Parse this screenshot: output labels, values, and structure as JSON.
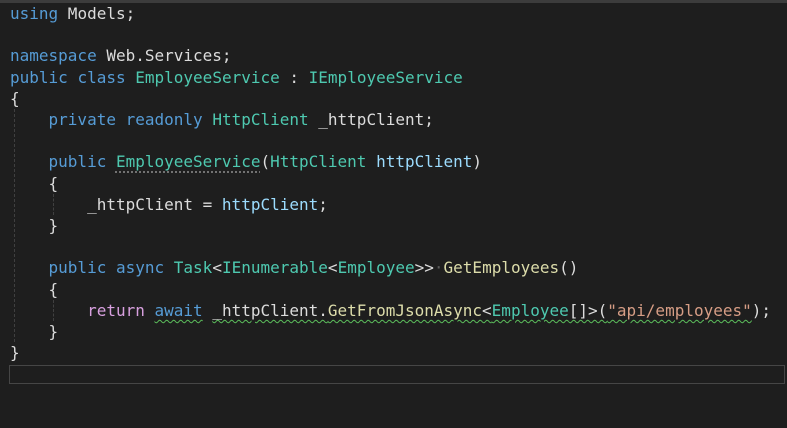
{
  "lines": [
    [
      {
        "t": "using",
        "c": "kw"
      },
      {
        "t": " Models;",
        "c": "pl"
      }
    ],
    [],
    [
      {
        "t": "namespace",
        "c": "kw"
      },
      {
        "t": " Web.Services;",
        "c": "pl"
      }
    ],
    [
      {
        "t": "public",
        "c": "kw"
      },
      {
        "t": " ",
        "c": "pl"
      },
      {
        "t": "class",
        "c": "kw"
      },
      {
        "t": " ",
        "c": "pl"
      },
      {
        "t": "EmployeeService",
        "c": "ty"
      },
      {
        "t": " : ",
        "c": "pl"
      },
      {
        "t": "IEmployeeService",
        "c": "ty"
      }
    ],
    [
      {
        "t": "{",
        "c": "pl"
      }
    ],
    [
      {
        "t": "    ",
        "c": "pl"
      },
      {
        "t": "private",
        "c": "kw"
      },
      {
        "t": " ",
        "c": "pl"
      },
      {
        "t": "readonly",
        "c": "kw"
      },
      {
        "t": " ",
        "c": "pl"
      },
      {
        "t": "HttpClient",
        "c": "ty"
      },
      {
        "t": " _httpClient;",
        "c": "pl"
      }
    ],
    [],
    [
      {
        "t": "    ",
        "c": "pl"
      },
      {
        "t": "public",
        "c": "kw"
      },
      {
        "t": " ",
        "c": "pl"
      },
      {
        "t": "EmployeeService",
        "c": "ty dots"
      },
      {
        "t": "(",
        "c": "pl"
      },
      {
        "t": "HttpClient",
        "c": "ty"
      },
      {
        "t": " ",
        "c": "pl"
      },
      {
        "t": "httpClient",
        "c": "pa"
      },
      {
        "t": ")",
        "c": "pl"
      }
    ],
    [
      {
        "t": "    {",
        "c": "pl"
      }
    ],
    [
      {
        "t": "        _httpClient = ",
        "c": "pl"
      },
      {
        "t": "httpClient",
        "c": "pa"
      },
      {
        "t": ";",
        "c": "pl"
      }
    ],
    [
      {
        "t": "    }",
        "c": "pl"
      }
    ],
    [],
    [
      {
        "t": "    ",
        "c": "pl"
      },
      {
        "t": "public",
        "c": "kw"
      },
      {
        "t": " ",
        "c": "pl"
      },
      {
        "t": "async",
        "c": "kw"
      },
      {
        "t": " ",
        "c": "pl"
      },
      {
        "t": "Task",
        "c": "ty"
      },
      {
        "t": "<",
        "c": "pl"
      },
      {
        "t": "IEnumerable",
        "c": "ty"
      },
      {
        "t": "<",
        "c": "pl"
      },
      {
        "t": "Employee",
        "c": "ty"
      },
      {
        "t": ">>",
        "c": "pl"
      },
      {
        "t": "·",
        "c": "ws"
      },
      {
        "t": "GetEmployees",
        "c": "me"
      },
      {
        "t": "()",
        "c": "pl"
      }
    ],
    [
      {
        "t": "    {",
        "c": "pl"
      }
    ],
    [
      {
        "t": "        ",
        "c": "pl"
      },
      {
        "t": "return",
        "c": "ctl"
      },
      {
        "t": " ",
        "c": "pl"
      },
      {
        "t": "await",
        "c": "kw squig"
      },
      {
        "t": " ",
        "c": "pl"
      },
      {
        "t": "_httpClient.",
        "c": "pl squig"
      },
      {
        "t": "GetFromJsonAsync",
        "c": "me squig"
      },
      {
        "t": "<",
        "c": "pl squig"
      },
      {
        "t": "Employee",
        "c": "ty squig"
      },
      {
        "t": "[]>(",
        "c": "pl squig"
      },
      {
        "t": "\"api/employees\"",
        "c": "st squig"
      },
      {
        "t": ");",
        "c": "pl"
      }
    ],
    [
      {
        "t": "    }",
        "c": "pl"
      }
    ],
    [
      {
        "t": "}",
        "c": "pl"
      }
    ]
  ]
}
